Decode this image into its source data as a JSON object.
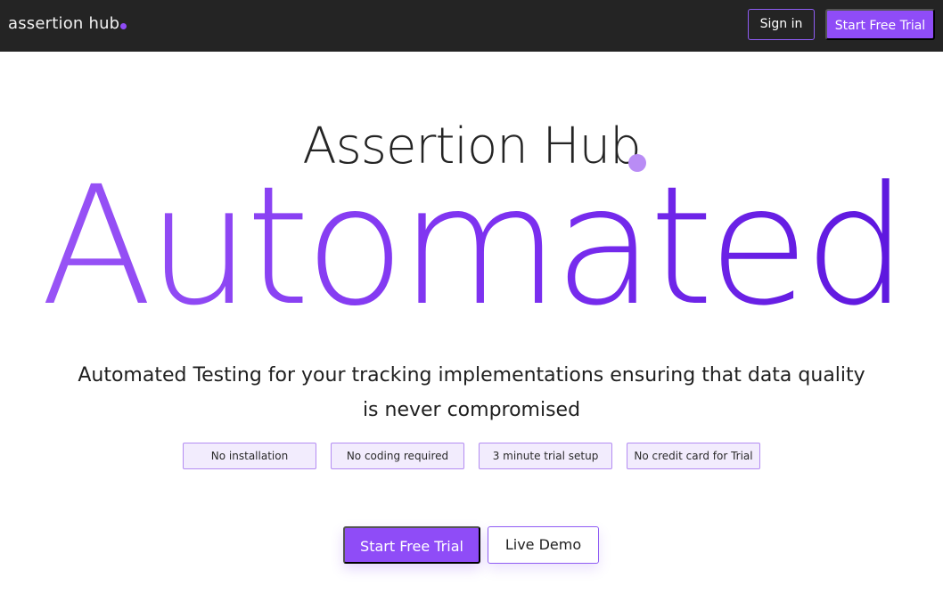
{
  "header": {
    "logo_text": "assertion hub",
    "sign_in_label": "Sign in",
    "start_trial_label": "Start Free Trial"
  },
  "hero": {
    "title": "Assertion Hub",
    "headline": "Automated",
    "subtitle": "Automated Testing for your tracking implementations ensuring that data quality is never compromised",
    "pills": [
      "No installation",
      "No coding required",
      "3 minute trial setup",
      "No credit card for Trial"
    ],
    "cta_primary": "Start Free Trial",
    "cta_secondary": "Live Demo"
  },
  "colors": {
    "accent": "#8f4cf7",
    "accent_light": "#b98cf5",
    "topbar_bg": "#242424",
    "pill_bg": "#f2ecfd",
    "pill_border": "#b48cf2"
  }
}
